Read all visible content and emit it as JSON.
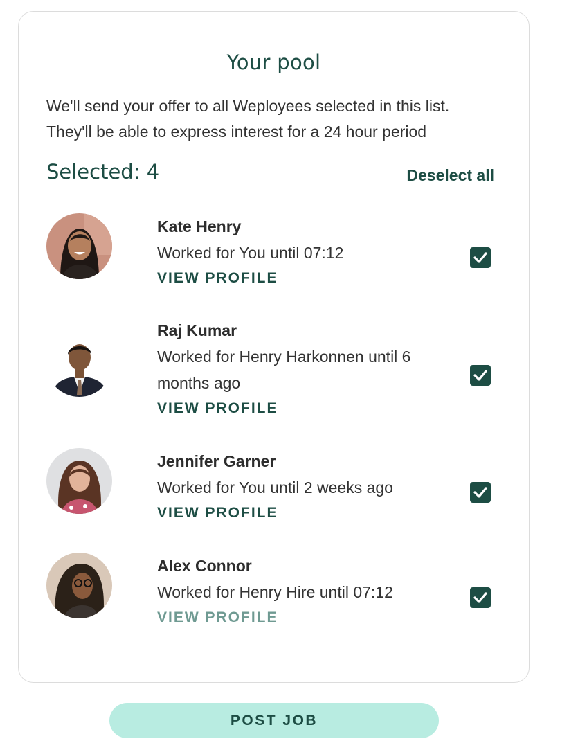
{
  "pool": {
    "title": "Your pool",
    "intro_lines": [
      "We'll send your offer to all Weployees selected in this list.",
      "They'll be able to express interest for a 24 hour period"
    ],
    "selected_label": "Selected: 4",
    "deselect_label": "Deselect all",
    "people": [
      {
        "name": "Kate Henry",
        "desc": "Worked for You until 07:12",
        "link": "VIEW PROFILE",
        "checked": true
      },
      {
        "name": "Raj Kumar",
        "desc": "Worked for Henry Harkonnen until 6 months ago",
        "link": "VIEW PROFILE",
        "checked": true
      },
      {
        "name": "Jennifer Garner",
        "desc": "Worked for You until 2 weeks ago",
        "link": "VIEW PROFILE",
        "checked": true
      },
      {
        "name": "Alex Connor",
        "desc": "Worked for Henry Hire until 07:12",
        "link": "VIEW PROFILE",
        "checked": true
      }
    ]
  },
  "footer": {
    "post_label": "POST JOB"
  },
  "colors": {
    "brand": "#1d4d44",
    "button_bg": "#b8ece1",
    "border": "#dcdcdc"
  },
  "icons": {
    "checkbox": "checkmark-icon"
  }
}
